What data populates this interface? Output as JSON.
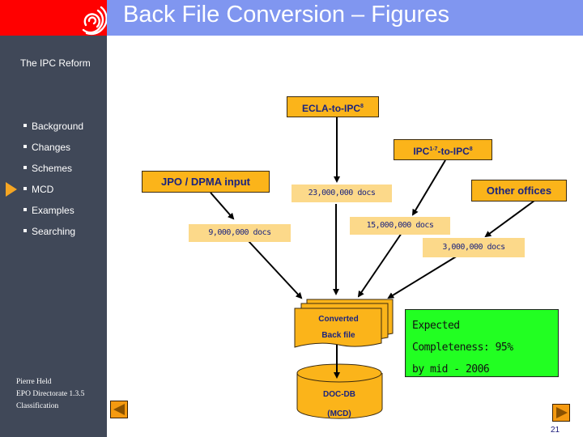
{
  "header": {
    "title": "Back File Conversion – Figures",
    "logo": "epo-logo-icon"
  },
  "sidebar": {
    "section": "The IPC Reform",
    "items": [
      {
        "label": "Background",
        "active": false
      },
      {
        "label": "Changes",
        "active": false
      },
      {
        "label": "Schemes",
        "active": false
      },
      {
        "label": "MCD",
        "active": true
      },
      {
        "label": "Examples",
        "active": false
      },
      {
        "label": "Searching",
        "active": false
      }
    ],
    "author": [
      "Pierre Held",
      "EPO Directorate 1.3.5",
      "Classification"
    ]
  },
  "diagram": {
    "sources": {
      "ecla": {
        "label": "ECLA-to-IPC",
        "sup": "8"
      },
      "ipc17": {
        "label_a": "IPC",
        "sup_a": "1-7",
        "label_b": "-to-IPC",
        "sup_b": "8"
      },
      "jpo": "JPO / DPMA input",
      "other": "Other offices"
    },
    "counts": {
      "ecla": "23,000,000 docs",
      "jpo": "9,000,000 docs",
      "ipc17": "15,000,000 docs",
      "other": "3,000,000 docs"
    },
    "converted": [
      "Converted",
      "Back file"
    ],
    "database": [
      "DOC-DB",
      "(MCD)"
    ],
    "completeness": [
      "Expected",
      "Completeness: 95%",
      "by mid - 2006"
    ]
  },
  "footer": {
    "page_number": "21",
    "prev": "previous-slide",
    "next": "next-slide"
  },
  "colors": {
    "header_red": "#ff0000",
    "title_blue": "#8096f0",
    "sidebar": "#404858",
    "box_orange": "#fbb41a",
    "count_fill": "#fcd98a",
    "green": "#22ff22"
  }
}
